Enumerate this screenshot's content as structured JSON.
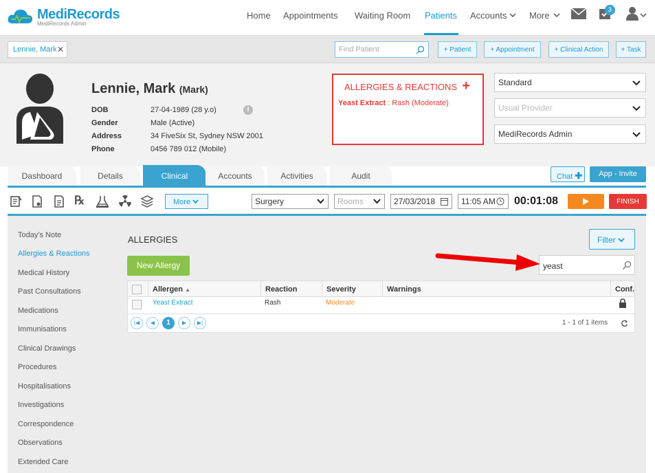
{
  "app": {
    "brand": "MediRecords",
    "subtitle": "MediRecords Admin"
  },
  "nav": {
    "items": [
      "Home",
      "Appointments",
      "Waiting Room",
      "Patients",
      "Accounts",
      "More"
    ],
    "active": "Patients",
    "notification_count": "3"
  },
  "toolbar_top": {
    "patient_tab": "Lennie, Mark",
    "find_patient_placeholder": "Find Patient",
    "buttons": [
      "+ Patient",
      "+ Appointment",
      "+ Clinical Action",
      "+ Task"
    ]
  },
  "patient": {
    "name": "Lennie, Mark",
    "preferred": "(Mark)",
    "fields": [
      {
        "label": "DOB",
        "value": "27-04-1989 (28 y.o)"
      },
      {
        "label": "Gender",
        "value": "Male (Active)"
      },
      {
        "label": "Address",
        "value": "34 FiveSix St, Sydney NSW 2001"
      },
      {
        "label": "Phone",
        "value": "0456 789 012 (Mobile)"
      }
    ]
  },
  "allergy_panel": {
    "title": "ALLERGIES & REACTIONS",
    "entry_allergen": "Yeast Extract",
    "entry_detail": " : Rash (Moderate)"
  },
  "selectors": {
    "type": "Standard",
    "provider_placeholder": "Usual Provider",
    "location": "MediRecords Admin"
  },
  "clinical_tabs": [
    "Dashboard",
    "Details",
    "Clinical",
    "Accounts",
    "Activities",
    "Audit"
  ],
  "active_tab": "Clinical",
  "chat_label": "Chat",
  "app_invite_label": "App - Invite",
  "consult_toolbar": {
    "more_label": "More",
    "location": "Surgery",
    "rooms_placeholder": "Rooms",
    "date": "27/03/2018",
    "time": "11:05 AM",
    "timer": "00:01:08",
    "finish_label": "FINISH"
  },
  "sidebar": {
    "items": [
      "Today's Note",
      "Allergies & Reactions",
      "Medical History",
      "Past Consultations",
      "Medications",
      "Immunisations",
      "Clinical Drawings",
      "Procedures",
      "Hospitalisations",
      "Investigations",
      "Correspondence",
      "Observations",
      "Extended Care"
    ],
    "active": "Allergies & Reactions"
  },
  "allergies": {
    "title": "ALLERGIES",
    "filter_label": "Filter",
    "new_label": "New Allergy",
    "search_value": "yeast",
    "columns": [
      "Allergen",
      "Reaction",
      "Severity",
      "Warnings",
      "Conf."
    ],
    "rows": [
      {
        "allergen": "Yeast Extract",
        "reaction": "Rash",
        "severity": "Moderate",
        "warnings": ""
      }
    ],
    "current_page": "1",
    "page_info": "1 - 1 of 1 items"
  },
  "colors": {
    "accent": "#3aa3cf",
    "alert": "#e53935",
    "orange": "#f5891f",
    "green": "#8bc34a"
  }
}
